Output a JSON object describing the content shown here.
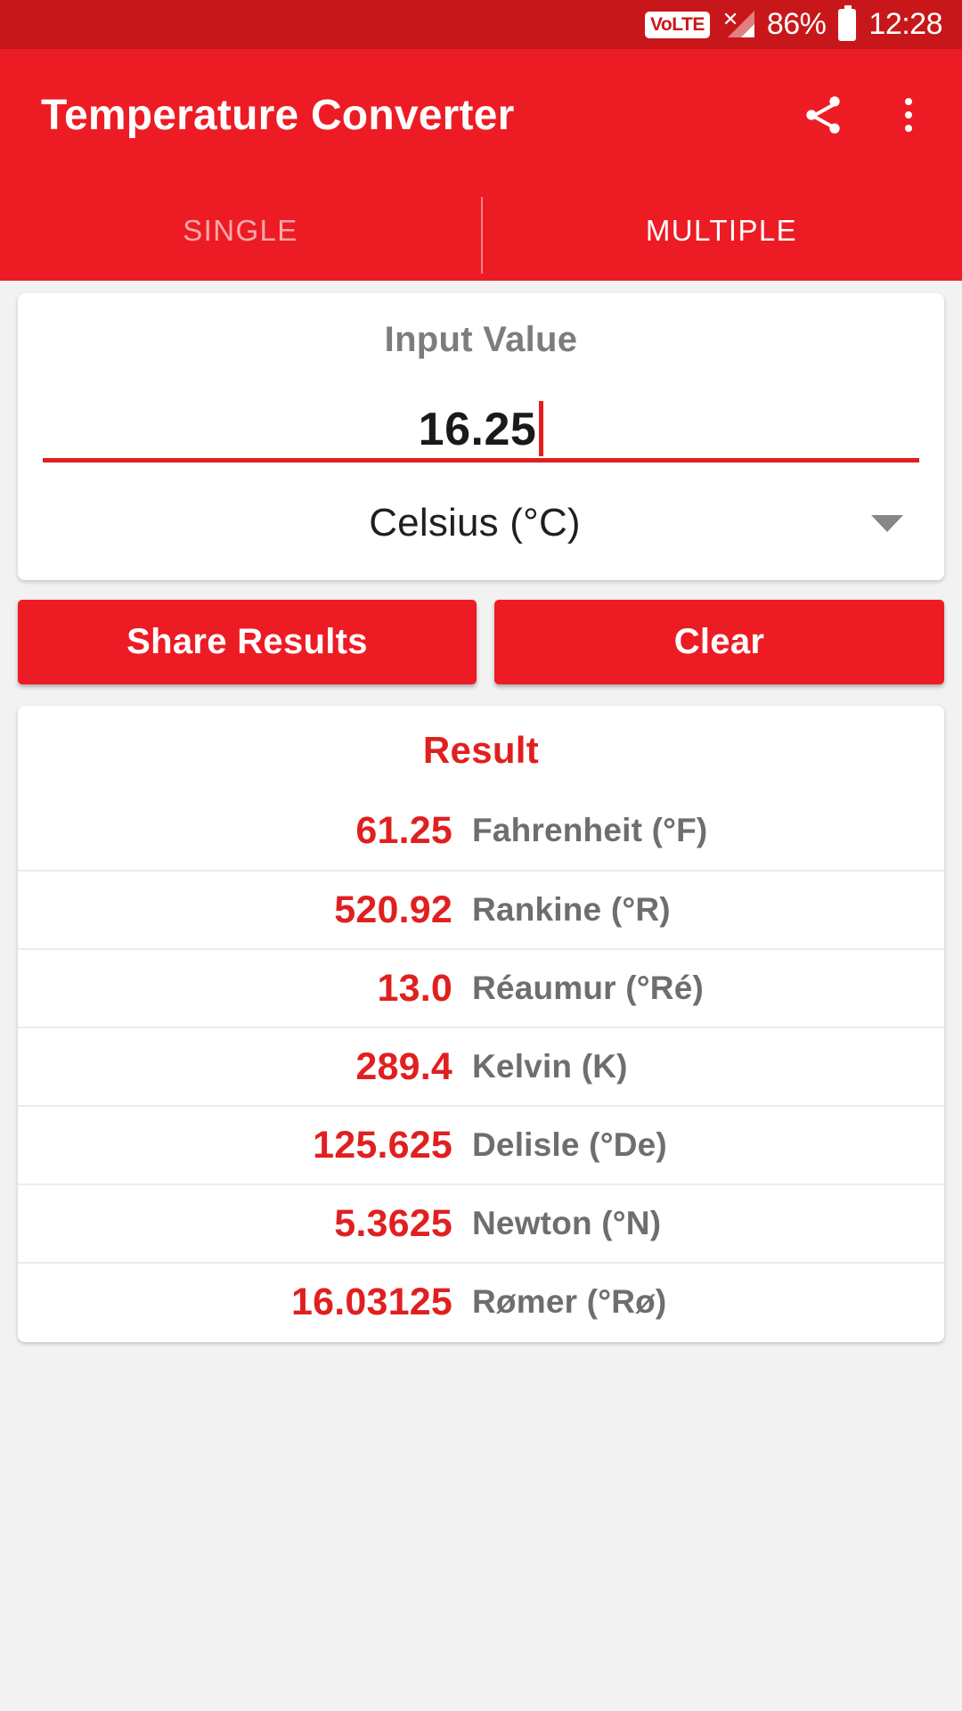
{
  "status_bar": {
    "volte_label": "VoLTE",
    "battery_percent": "86%",
    "clock": "12:28",
    "signal_icon": "no-signal-icon",
    "battery_icon": "battery-icon"
  },
  "appbar": {
    "title": "Temperature Converter",
    "share_icon": "share-icon",
    "overflow_icon": "overflow-menu-icon",
    "tabs": [
      {
        "label": "SINGLE",
        "active": false
      },
      {
        "label": "MULTIPLE",
        "active": true
      }
    ]
  },
  "input_card": {
    "label": "Input Value",
    "value": "16.25",
    "placeholder": "",
    "unit_selected": "Celsius (°C)",
    "dropdown_icon": "chevron-down-icon"
  },
  "actions": {
    "share_label": "Share Results",
    "clear_label": "Clear"
  },
  "result": {
    "title": "Result",
    "rows": [
      {
        "value": "61.25",
        "unit": "Fahrenheit (°F)"
      },
      {
        "value": "520.92",
        "unit": "Rankine (°R)"
      },
      {
        "value": "13.0",
        "unit": "Réaumur (°Ré)"
      },
      {
        "value": "289.4",
        "unit": "Kelvin (K)"
      },
      {
        "value": "125.625",
        "unit": "Delisle (°De)"
      },
      {
        "value": "5.3625",
        "unit": "Newton (°N)"
      },
      {
        "value": "16.03125",
        "unit": "Rømer (°Rø)"
      }
    ]
  },
  "colors": {
    "primary": "#ed1c24",
    "primary_dark": "#c8171a",
    "accent_red": "#e02020",
    "muted_gray": "#6e6e6e",
    "page_bg": "#f2f2f2"
  }
}
